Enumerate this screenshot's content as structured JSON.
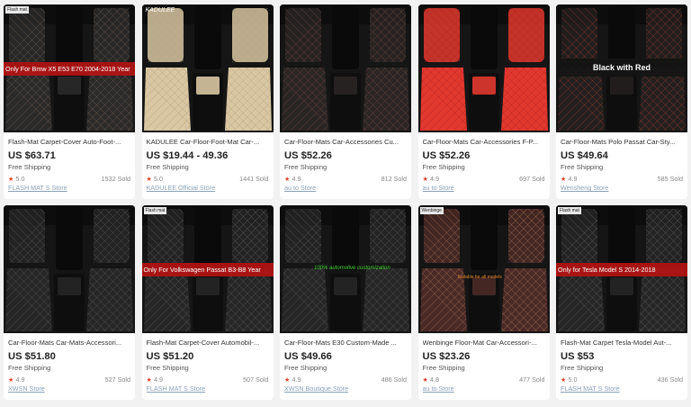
{
  "products": [
    {
      "title": "Flash-Mat Carpet-Cover Auto-Foot-...",
      "price": "US $63.71",
      "shipping": "Free Shipping",
      "rating": "5.0",
      "sold": "1532 Sold",
      "store": "FLASH MAT S Store",
      "tag": "Flash mat",
      "tag_style": "dark",
      "banner": "Only For Bmw X5 E53 E70 2004-2018 Year",
      "banner_style": "red",
      "mat_color": "#2a2a2a",
      "stitch_color": "#6a5a50"
    },
    {
      "title": "KADULEE Car-Floor-Foot-Mat Car-...",
      "price": "US $19.44 - 49.36",
      "shipping": "Free Shipping",
      "rating": "5.0",
      "sold": "1441 Sold",
      "store": "KADULEE Official Store",
      "tag": "KADULEE",
      "tag_style": "light",
      "banner": "",
      "banner_style": "",
      "mat_color": "#d9c7a3",
      "stitch_color": "#b8a581"
    },
    {
      "title": "Car-Floor-Mats Car-Accessories Cu...",
      "price": "US $52.26",
      "shipping": "Free Shipping",
      "rating": "4.9",
      "sold": "812 Sold",
      "store": "au to Store",
      "tag": "",
      "tag_style": "",
      "banner": "",
      "banner_style": "",
      "mat_color": "#2a2525",
      "stitch_color": "#6b4a40"
    },
    {
      "title": "Car-Floor-Mats Car-Accessories F-P...",
      "price": "US $52.26",
      "shipping": "Free Shipping",
      "rating": "4.9",
      "sold": "697 Sold",
      "store": "au to Store",
      "tag": "",
      "tag_style": "",
      "banner": "",
      "banner_style": "",
      "mat_color": "#e2392f",
      "stitch_color": "#b82420"
    },
    {
      "title": "Car-Floor-Mats Polo Passat Car-Sty...",
      "price": "US $49.64",
      "shipping": "Free Shipping",
      "rating": "4.9",
      "sold": "585 Sold",
      "store": "Wensheng Store",
      "tag": "",
      "tag_style": "",
      "banner": "Black with Red",
      "banner_style": "black",
      "mat_color": "#231f1f",
      "stitch_color": "#8a3a30"
    },
    {
      "title": "Car-Floor-Mats Car-Mats-Accessori...",
      "price": "US $51.80",
      "shipping": "Free Shipping",
      "rating": "4.9",
      "sold": "527 Sold",
      "store": "XWSN Store",
      "tag": "",
      "tag_style": "",
      "banner": "",
      "banner_style": "",
      "mat_color": "#262626",
      "stitch_color": "#555555"
    },
    {
      "title": "Flash-Mat Carpet-Cover Automobil-...",
      "price": "US $51.20",
      "shipping": "Free Shipping",
      "rating": "4.9",
      "sold": "507 Sold",
      "store": "FLASH MAT S Store",
      "tag": "Flash mat",
      "tag_style": "dark",
      "banner": "Only For Volkswagen Passat B3-B8 Year",
      "banner_style": "red",
      "mat_color": "#262626",
      "stitch_color": "#5a5a5a"
    },
    {
      "title": "Car-Floor-Mats E30 Custom-Made ...",
      "price": "US $49.66",
      "shipping": "Free Shipping",
      "rating": "4.9",
      "sold": "486 Sold",
      "store": "XWSN Boutique Store",
      "tag": "",
      "tag_style": "",
      "banner": "100% automotive customization",
      "banner_style": "green",
      "mat_color": "#262626",
      "stitch_color": "#585858"
    },
    {
      "title": "Wenbinge Floor-Mat Car-Accessori-...",
      "price": "US $23.26",
      "shipping": "Free Shipping",
      "rating": "4.8",
      "sold": "477 Sold",
      "store": "au to Store",
      "tag": "Wenbinge",
      "tag_style": "dark",
      "banner": "Suitable for all models",
      "banner_style": "orange",
      "mat_color": "#4a2a26",
      "stitch_color": "#9a6a55"
    },
    {
      "title": "Flash-Mat Carpet Tesla-Model Aut-...",
      "price": "US $53",
      "shipping": "Free Shipping",
      "rating": "5.0",
      "sold": "436 Sold",
      "store": "FLASH MAT S Store",
      "tag": "Flash mat",
      "tag_style": "dark",
      "banner": "Only for Tesla Model S  2014-2018",
      "banner_style": "red",
      "mat_color": "#262626",
      "stitch_color": "#5a5a5a"
    }
  ]
}
